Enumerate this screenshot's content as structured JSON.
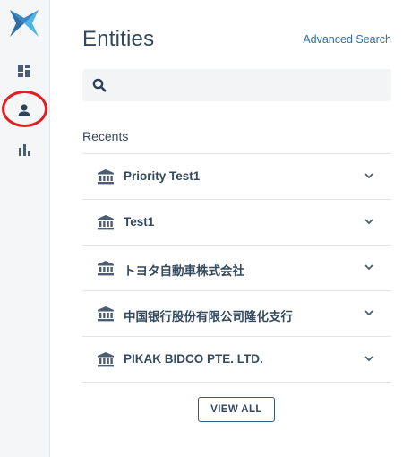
{
  "colors": {
    "sidebar_bg": "#f5f6f8",
    "logo_primary": "#2f6fa8",
    "logo_accent": "#4fb4e6",
    "text_primary": "#33475d",
    "link": "#2f6fa8",
    "annotation": "#e01e24"
  },
  "sidebar": {
    "items": [
      {
        "icon": "dashboard-icon"
      },
      {
        "icon": "person-icon"
      },
      {
        "icon": "bar-chart-icon"
      }
    ]
  },
  "header": {
    "title": "Entities",
    "advanced_search": "Advanced Search"
  },
  "search": {
    "placeholder": ""
  },
  "recents": {
    "label": "Recents",
    "items": [
      {
        "name": "Priority Test1",
        "icon": "bank-icon"
      },
      {
        "name": "Test1",
        "icon": "bank-icon"
      },
      {
        "name": "トヨタ自動車株式会社",
        "icon": "bank-icon"
      },
      {
        "name": "中国银行股份有限公司隆化支行",
        "icon": "bank-icon"
      },
      {
        "name": "PIKAK BIDCO PTE. LTD.",
        "icon": "bank-icon"
      }
    ],
    "view_all": "VIEW ALL"
  }
}
